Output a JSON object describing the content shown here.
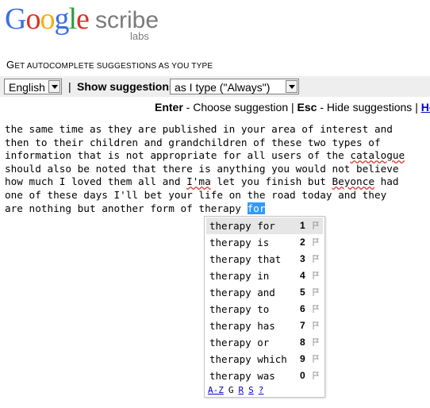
{
  "logo": {
    "google": [
      "G",
      "o",
      "o",
      "g",
      "l",
      "e"
    ],
    "google_colors": [
      "#3c6fe0",
      "#d8322c",
      "#f1b00e",
      "#3c6fe0",
      "#2a9c3a",
      "#d8322c"
    ],
    "product": "scribe",
    "sub": "labs"
  },
  "tagline": {
    "first": "G",
    "rest": "ET AUTOCOMPLETE SUGGESTIONS AS YOU TYPE"
  },
  "toolbar": {
    "language": "English",
    "separator": "|",
    "show_label": "Show suggestions",
    "mode": "as I type (\"Always\")"
  },
  "shortcuts": {
    "enter_key": "Enter",
    "enter_text": " - Choose suggestion ",
    "sep": "|",
    "esc_key": "Esc",
    "esc_text": " - Hide suggestions ",
    "help": "Hel"
  },
  "editor": {
    "lines": [
      "the same time as they are published in your area of interest and",
      "then to their children and grandchildren of these two types of",
      "information that is not appropriate for all users of the catalogue",
      "should also be noted that there is anything you would not believe",
      "how much I loved them all and I'ma let you finish but Beyonce had",
      "one of these days I'll bet your life on the road today and they",
      "are nothing but another form of therapy "
    ],
    "selected_word": "for"
  },
  "suggestions": [
    {
      "text": "therapy for",
      "num": "1"
    },
    {
      "text": "therapy is",
      "num": "2"
    },
    {
      "text": "therapy that",
      "num": "3"
    },
    {
      "text": "therapy in",
      "num": "4"
    },
    {
      "text": "therapy and",
      "num": "5"
    },
    {
      "text": "therapy to",
      "num": "6"
    },
    {
      "text": "therapy has",
      "num": "7"
    },
    {
      "text": "therapy or",
      "num": "8"
    },
    {
      "text": "therapy which",
      "num": "9"
    },
    {
      "text": "therapy was",
      "num": "0"
    }
  ],
  "sort_options": [
    "A-Z",
    "G",
    "R",
    "S",
    "?"
  ],
  "colors": {
    "selection": "#3399ff",
    "link": "#0000cc",
    "toolbar_bg": "#eeeeee"
  }
}
